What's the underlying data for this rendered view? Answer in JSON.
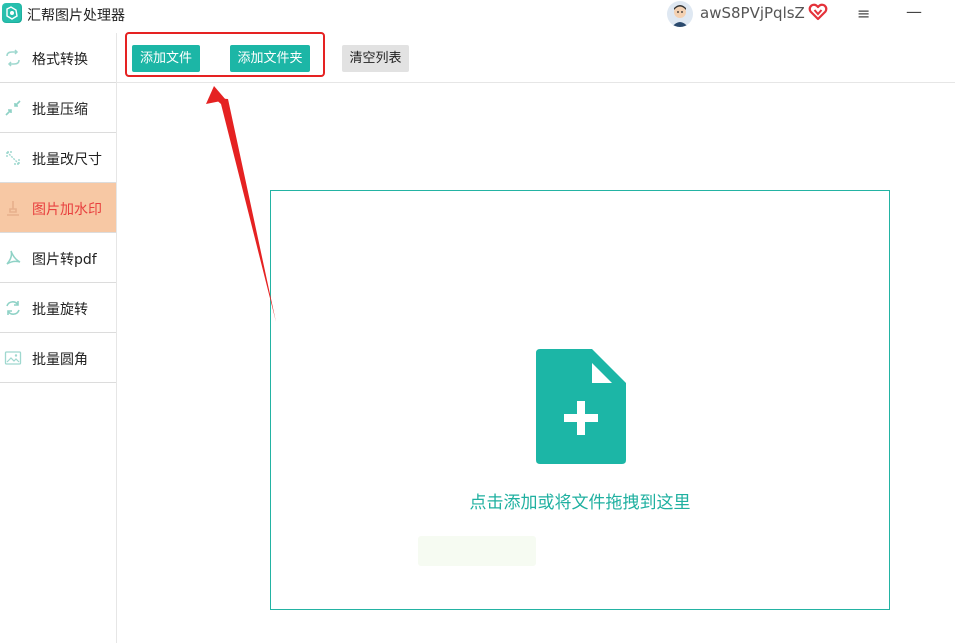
{
  "app": {
    "title": "汇帮图片处理器",
    "username": "awS8PVjPqlsZ",
    "logo_icon": "app-logo-icon",
    "avatar_icon": "user-avatar",
    "vip_icon": "vip-heart-icon",
    "menu_icon": "hamburger-menu-icon",
    "minimize_icon": "minimize-icon",
    "menu_glyph": "≡",
    "minimize_glyph": "—"
  },
  "sidebar": {
    "items": [
      {
        "label": "格式转换",
        "icon": "format-convert-icon",
        "active": false
      },
      {
        "label": "批量压缩",
        "icon": "compress-icon",
        "active": false
      },
      {
        "label": "批量改尺寸",
        "icon": "resize-icon",
        "active": false
      },
      {
        "label": "图片加水印",
        "icon": "watermark-icon",
        "active": true
      },
      {
        "label": "图片转pdf",
        "icon": "pdf-icon",
        "active": false
      },
      {
        "label": "批量旋转",
        "icon": "rotate-icon",
        "active": false
      },
      {
        "label": "批量圆角",
        "icon": "round-corner-icon",
        "active": false
      }
    ]
  },
  "toolbar": {
    "add_file_label": "添加文件",
    "add_folder_label": "添加文件夹",
    "clear_list_label": "清空列表"
  },
  "dropzone": {
    "hint": "点击添加或将文件拖拽到这里",
    "icon": "file-add-icon"
  },
  "colors": {
    "accent": "#1cb6a6",
    "active_nav_bg": "#f7c8a4",
    "active_nav_text": "#e8403f",
    "annotation_red": "#e52222"
  }
}
